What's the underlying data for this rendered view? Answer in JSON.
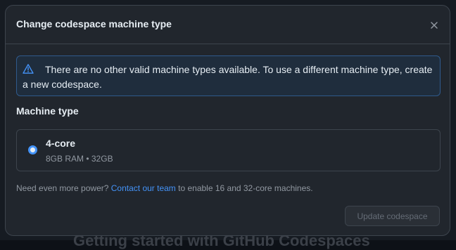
{
  "background": {
    "text": "Getting started with GitHub Codespaces"
  },
  "dialog": {
    "title": "Change codespace machine type",
    "close_icon": "close-icon",
    "flash": {
      "icon": "alert-triangle-icon",
      "text": "There are no other valid machine types available. To use a different machine type, create a new codespace."
    },
    "machine_type_label": "Machine type",
    "option": {
      "name": "4-core",
      "description": "8GB RAM • 32GB",
      "selected": true
    },
    "note": {
      "prefix": "Need even more power? ",
      "link": "Contact our team",
      "suffix": " to enable 16 and 32-core machines."
    },
    "update_button": "Update codespace",
    "colors": {
      "accent": "#4493f8",
      "dialog_bg": "#21262d",
      "border": "#3d444d",
      "flash_bg": "#1f2d3d"
    }
  }
}
